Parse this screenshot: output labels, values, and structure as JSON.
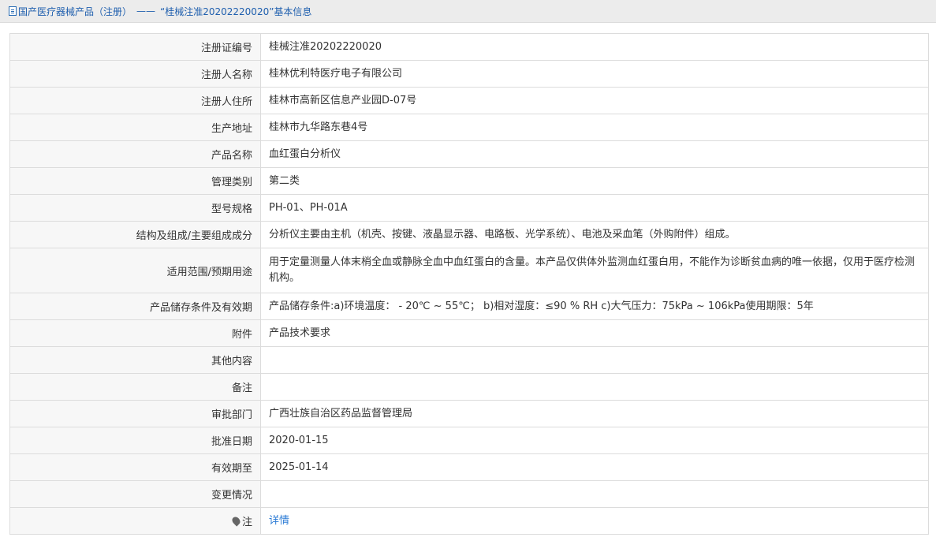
{
  "breadcrumb": {
    "section": "国产医疗器械产品（注册）",
    "separator": "——",
    "current": "“桂械注准20202220020”基本信息"
  },
  "rows": [
    {
      "label": "注册证编号",
      "value": "桂械注准20202220020"
    },
    {
      "label": "注册人名称",
      "value": "桂林优利特医疗电子有限公司"
    },
    {
      "label": "注册人住所",
      "value": "桂林市高新区信息产业园D-07号"
    },
    {
      "label": "生产地址",
      "value": "桂林市九华路东巷4号"
    },
    {
      "label": "产品名称",
      "value": "血红蛋白分析仪"
    },
    {
      "label": "管理类别",
      "value": "第二类"
    },
    {
      "label": "型号规格",
      "value": "PH-01、PH-01A"
    },
    {
      "label": "结构及组成/主要组成成分",
      "value": "分析仪主要由主机（机壳、按键、液晶显示器、电路板、光学系统）、电池及采血笔（外购附件）组成。"
    },
    {
      "label": "适用范围/预期用途",
      "value": "用于定量测量人体末梢全血或静脉全血中血红蛋白的含量。本产品仅供体外监测血红蛋白用，不能作为诊断贫血病的唯一依据，仅用于医疗检测机构。"
    },
    {
      "label": "产品储存条件及有效期",
      "value": "产品储存条件:a)环境温度： - 20℃ ~ 55℃； b)相对湿度：≤90 % RH c)大气压力：75kPa ~ 106kPa使用期限：5年"
    },
    {
      "label": "附件",
      "value": "产品技术要求"
    },
    {
      "label": "其他内容",
      "value": ""
    },
    {
      "label": "备注",
      "value": ""
    },
    {
      "label": "审批部门",
      "value": "广西壮族自治区药品监督管理局"
    },
    {
      "label": "批准日期",
      "value": "2020-01-15"
    },
    {
      "label": "有效期至",
      "value": "2025-01-14"
    },
    {
      "label": "变更情况",
      "value": ""
    }
  ],
  "note_row": {
    "label": "注",
    "link_text": "详情"
  }
}
